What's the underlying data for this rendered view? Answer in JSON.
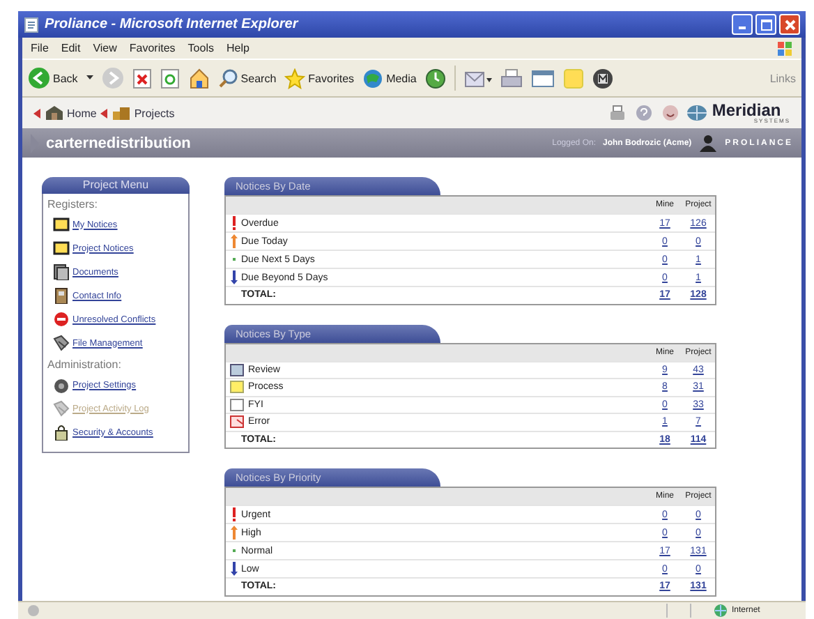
{
  "window": {
    "title": "Proliance - Microsoft Internet Explorer"
  },
  "menu": [
    "File",
    "Edit",
    "View",
    "Favorites",
    "Tools",
    "Help"
  ],
  "toolbar": {
    "back": "Back",
    "search": "Search",
    "favorites": "Favorites",
    "media": "Media",
    "links": "Links"
  },
  "breadcrumb": [
    "Home",
    "Projects"
  ],
  "brand": {
    "name": "Meridian",
    "tagline": "SYSTEMS"
  },
  "banner": {
    "project": "carternedistribution",
    "logged_label": "Logged On:",
    "user": "John Bodrozic (Acme)",
    "product": "PROLIANCE"
  },
  "sidebar": {
    "title": "Project Menu",
    "sections": [
      {
        "heading": "Registers:",
        "items": [
          {
            "label": "My Notices",
            "kind": "note",
            "disabled": false
          },
          {
            "label": "Project Notices",
            "kind": "note",
            "disabled": false
          },
          {
            "label": "Documents",
            "kind": "document",
            "disabled": false
          },
          {
            "label": "Contact Info",
            "kind": "contact",
            "disabled": false
          },
          {
            "label": "Unresolved Conflicts",
            "kind": "conflict",
            "disabled": false
          },
          {
            "label": "File Management",
            "kind": "files",
            "disabled": false
          }
        ]
      },
      {
        "heading": "Administration:",
        "items": [
          {
            "label": "Project Settings",
            "kind": "settings",
            "disabled": false
          },
          {
            "label": "Project Activity Log",
            "kind": "files",
            "disabled": true
          },
          {
            "label": "Security & Accounts",
            "kind": "lock",
            "disabled": false
          }
        ]
      }
    ]
  },
  "panels": [
    {
      "title": "Notices By Date",
      "columns": [
        "Mine",
        "Project"
      ],
      "rows": [
        {
          "kind": "urgent",
          "label": "Overdue",
          "mine": "17",
          "project": "126"
        },
        {
          "kind": "high",
          "label": "Due Today",
          "mine": "0",
          "project": "0"
        },
        {
          "kind": "normal",
          "label": "Due Next 5 Days",
          "mine": "0",
          "project": "1"
        },
        {
          "kind": "low",
          "label": "Due Beyond 5 Days",
          "mine": "0",
          "project": "1"
        }
      ],
      "total": {
        "label": "TOTAL:",
        "mine": "17",
        "project": "128"
      }
    },
    {
      "title": "Notices By Type",
      "columns": [
        "Mine",
        "Project"
      ],
      "rows": [
        {
          "kind": "review",
          "label": "Review",
          "mine": "9",
          "project": "43"
        },
        {
          "kind": "process",
          "label": "Process",
          "mine": "8",
          "project": "31"
        },
        {
          "kind": "fyi",
          "label": "FYI",
          "mine": "0",
          "project": "33"
        },
        {
          "kind": "error",
          "label": "Error",
          "mine": "1",
          "project": "7"
        }
      ],
      "total": {
        "label": "TOTAL:",
        "mine": "18",
        "project": "114"
      }
    },
    {
      "title": "Notices By Priority",
      "columns": [
        "Mine",
        "Project"
      ],
      "rows": [
        {
          "kind": "urgent",
          "label": "Urgent",
          "mine": "0",
          "project": "0"
        },
        {
          "kind": "high",
          "label": "High",
          "mine": "0",
          "project": "0"
        },
        {
          "kind": "normal",
          "label": "Normal",
          "mine": "17",
          "project": "131"
        },
        {
          "kind": "low",
          "label": "Low",
          "mine": "0",
          "project": "0"
        }
      ],
      "total": {
        "label": "TOTAL:",
        "mine": "17",
        "project": "131"
      }
    }
  ],
  "status_bar": {
    "zone": "Internet"
  }
}
